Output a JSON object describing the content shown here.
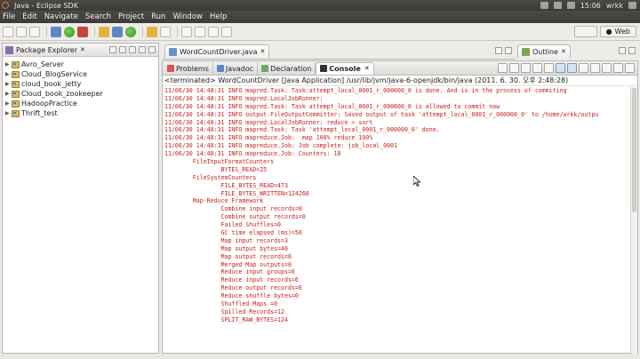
{
  "window": {
    "title": "Java - Eclipse SDK",
    "clock": "15:06",
    "user": "wrkk"
  },
  "menu": [
    "File",
    "Edit",
    "Navigate",
    "Search",
    "Project",
    "Run",
    "Window",
    "Help"
  ],
  "perspective": {
    "label": "Web"
  },
  "package_explorer": {
    "title": "Package Explorer",
    "projects": [
      "Avro_Server",
      "Cloud_BlogService",
      "cloud_book_jetty",
      "Cloud_book_zookeeper",
      "HadoopPractice",
      "Thrift_test"
    ]
  },
  "editor": {
    "tab_label": "WordCountDriver.java"
  },
  "outline": {
    "title": "Outline"
  },
  "console": {
    "tabs": [
      "Problems",
      "Javadoc",
      "Declaration",
      "Console"
    ],
    "active_tab": "Console",
    "status": "<terminated> WordCountDriver [Java Application] /usr/lib/jvm/java-6-openjdk/bin/java (2011. 6. 30. 오후 2:48:28)",
    "lines": [
      "11/06/30 14:48:31 INFO mapred.Task: Task:attempt_local_0001_r_000000_0 is done. And is in the process of commiting",
      "11/06/30 14:48:31 INFO mapred.LocalJobRunner:",
      "11/06/30 14:48:31 INFO mapred.Task: Task attempt_local_0001_r_000000_0 is allowed to commit now",
      "11/06/30 14:48:31 INFO output.FileOutputCommitter: Saved output of task 'attempt_local_0001_r_000000_0' to /home/wrkk/outpu",
      "11/06/30 14:48:31 INFO mapred.LocalJobRunner: reduce > sort",
      "11/06/30 14:48:31 INFO mapred.Task: Task 'attempt_local_0001_r_000000_0' done.",
      "11/06/30 14:48:31 INFO mapreduce.Job:  map 100% reduce 100%",
      "11/06/30 14:48:31 INFO mapreduce.Job: Job complete: job_local_0001",
      "11/06/30 14:48:31 INFO mapreduce.Job: Counters: 18",
      "        FileInputFormatCounters",
      "                BYTES_READ=25",
      "        FileSystemCounters",
      "                FILE_BYTES_READ=473",
      "                FILE_BYTES_WRITTEN=124260",
      "        Map-Reduce Framework",
      "                Combine input records=0",
      "                Combine output records=0",
      "                Failed Shuffles=0",
      "                GC time elapsed (ms)=56",
      "                Map input records=3",
      "                Map output bytes=40",
      "                Map output records=6",
      "                Merged Map outputs=0",
      "                Reduce input groups=6",
      "                Reduce input records=6",
      "                Reduce output records=6",
      "                Reduce shuffle bytes=0",
      "                Shuffled Maps =0",
      "                Spilled Records=12",
      "                SPLIT_RAW_BYTES=124"
    ]
  },
  "colors": {
    "console_text": "#c8201b",
    "topbar": "#3c3b37",
    "ubuntu_accent": "#e07a2f"
  }
}
